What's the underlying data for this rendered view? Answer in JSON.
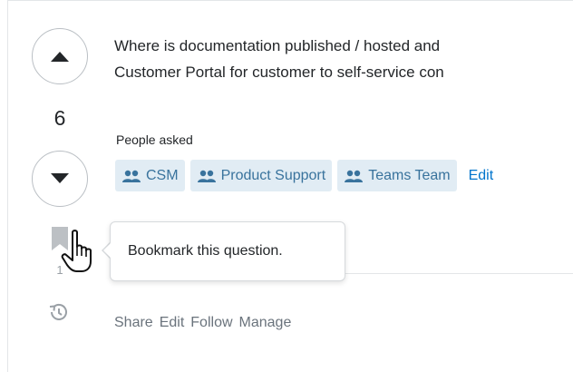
{
  "question": {
    "line1": "Where is documentation published / hosted and",
    "line2": "Customer Portal for customer to self-service con"
  },
  "votes": {
    "count": "6",
    "bookmark_count": "1"
  },
  "people": {
    "label": "People asked",
    "tags": [
      "CSM",
      "Product Support",
      "Teams Team"
    ],
    "edit_label": "Edit"
  },
  "tooltip": {
    "text": "Bookmark this question."
  },
  "actions": {
    "share": "Share",
    "edit": "Edit",
    "follow": "Follow",
    "manage": "Manage"
  },
  "colors": {
    "tag_bg": "#e1ecf4",
    "tag_text": "#39739d",
    "link": "#0074cc",
    "muted": "#6a737c"
  },
  "icons": {
    "upvote": "triangle-up-icon",
    "downvote": "triangle-down-icon",
    "bookmark": "bookmark-icon",
    "history": "history-icon",
    "team": "users-icon",
    "cursor": "hand-pointer-icon"
  }
}
